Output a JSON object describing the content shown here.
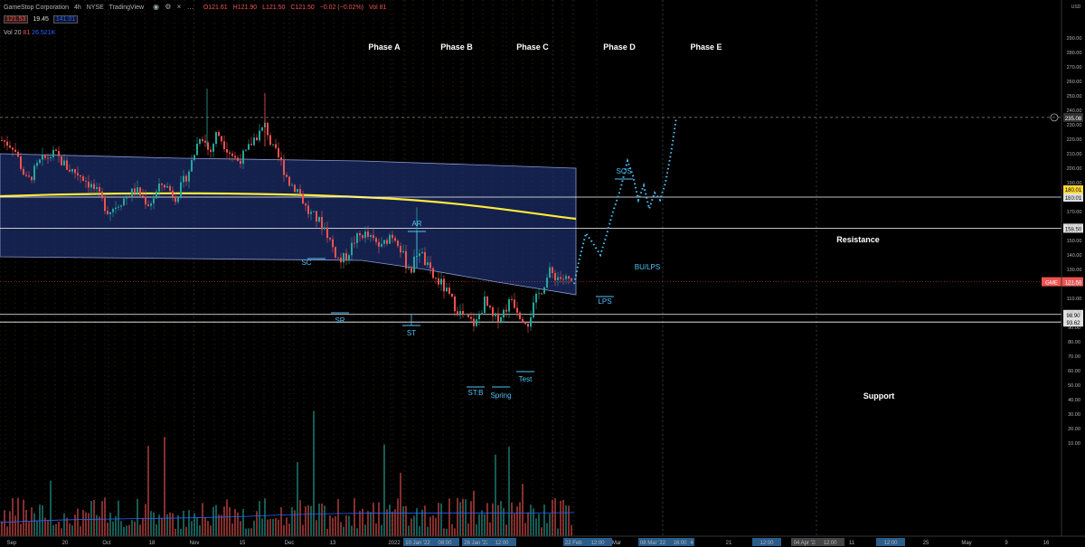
{
  "header": {
    "symbol": "GameStop Corporation",
    "interval": "4h",
    "exchange": "NYSE",
    "platform": "TradingView",
    "ohlc": {
      "o": "O121.61",
      "h": "H121.90",
      "l": "L121.50",
      "c": "C121.50",
      "chg": "−0.02 (−0.02%)",
      "vol": "Vol 81"
    },
    "bid": "121.53",
    "spread": "19.45",
    "ask": "141.01",
    "volume_label": "Vol 20",
    "volume_value": "81",
    "volume_ma": "26.521K",
    "icons": [
      "eye-icon",
      "settings-icon",
      "close-icon",
      "more-icon"
    ]
  },
  "colors": {
    "bg": "#000000",
    "up": "#26a69a",
    "down": "#ef5350",
    "band": "#1e2f6e",
    "ma": "#ffeb3b",
    "annot": "#4fc3f7",
    "line": "#ffffff"
  },
  "chart_data": {
    "type": "candlestick",
    "ylim": [
      0,
      300
    ],
    "ytick_labels": [
      "290.00",
      "280.00",
      "270.00",
      "260.00",
      "250.00",
      "240.00",
      "230.00",
      "220.00",
      "210.00",
      "200.00",
      "190.00",
      "180.00",
      "170.00",
      "160.00",
      "150.00",
      "140.00",
      "130.00",
      "120.00",
      "110.00",
      "100.00",
      "90.00",
      "80.00",
      "70.00",
      "60.00",
      "50.00",
      "40.00",
      "30.00",
      "20.00",
      "10.00"
    ],
    "ytick_values": [
      290,
      280,
      270,
      260,
      250,
      240,
      230,
      220,
      210,
      200,
      190,
      180,
      170,
      160,
      150,
      140,
      130,
      120,
      110,
      100,
      90,
      80,
      70,
      60,
      50,
      40,
      30,
      20,
      10
    ],
    "currency": "USD",
    "xtick_labels": [
      "Sep",
      "20",
      "Oct",
      "18",
      "Nov",
      "15",
      "Dec",
      "13",
      "2022",
      "10 Jan '22",
      "08:00",
      "26 Jan '22",
      "12:00",
      "22 Feb '22",
      "12:00",
      "Mar",
      "08 Mar '22",
      "16:00",
      "4",
      "21",
      "12:00",
      "04 Apr '22",
      "12:00",
      "11",
      "12:00",
      "25",
      "May",
      "9",
      "16"
    ],
    "price_path": [
      [
        0,
        220
      ],
      [
        15,
        215
      ],
      [
        30,
        190
      ],
      [
        45,
        205
      ],
      [
        60,
        210
      ],
      [
        75,
        200
      ],
      [
        90,
        195
      ],
      [
        105,
        185
      ],
      [
        120,
        170
      ],
      [
        135,
        178
      ],
      [
        150,
        185
      ],
      [
        165,
        175
      ],
      [
        180,
        190
      ],
      [
        195,
        180
      ],
      [
        210,
        200
      ],
      [
        222,
        225
      ],
      [
        232,
        210
      ],
      [
        240,
        225
      ],
      [
        250,
        215
      ],
      [
        262,
        205
      ],
      [
        272,
        210
      ],
      [
        280,
        220
      ],
      [
        288,
        225
      ],
      [
        294,
        230
      ],
      [
        300,
        215
      ],
      [
        310,
        205
      ],
      [
        320,
        190
      ],
      [
        330,
        185
      ],
      [
        340,
        170
      ],
      [
        350,
        165
      ],
      [
        360,
        158
      ],
      [
        368,
        145
      ],
      [
        376,
        135
      ],
      [
        384,
        140
      ],
      [
        392,
        150
      ],
      [
        402,
        155
      ],
      [
        412,
        150
      ],
      [
        422,
        145
      ],
      [
        432,
        155
      ],
      [
        440,
        150
      ],
      [
        448,
        135
      ],
      [
        455,
        130
      ],
      [
        463,
        145
      ],
      [
        470,
        135
      ],
      [
        478,
        125
      ],
      [
        488,
        120
      ],
      [
        498,
        110
      ],
      [
        508,
        100
      ],
      [
        518,
        95
      ],
      [
        526,
        92
      ],
      [
        536,
        108
      ],
      [
        546,
        95
      ],
      [
        556,
        100
      ],
      [
        566,
        110
      ],
      [
        576,
        98
      ],
      [
        584,
        94
      ],
      [
        592,
        108
      ],
      [
        600,
        118
      ],
      [
        608,
        128
      ],
      [
        616,
        125
      ],
      [
        626,
        123
      ],
      [
        635,
        120
      ]
    ],
    "projection": [
      [
        635,
        120
      ],
      [
        640,
        135
      ],
      [
        648,
        155
      ],
      [
        656,
        148
      ],
      [
        664,
        140
      ],
      [
        670,
        152
      ],
      [
        678,
        170
      ],
      [
        686,
        185
      ],
      [
        694,
        205
      ],
      [
        700,
        195
      ],
      [
        706,
        178
      ],
      [
        712,
        188
      ],
      [
        718,
        172
      ],
      [
        724,
        183
      ],
      [
        730,
        178
      ],
      [
        736,
        190
      ],
      [
        742,
        210
      ],
      [
        748,
        235
      ]
    ],
    "ma_label": "",
    "levels": [
      {
        "name": "Resistance",
        "value": 180.01,
        "label": "180.01"
      },
      {
        "name": "",
        "value": 158.5,
        "label": "158.50"
      },
      {
        "name": "Support",
        "value": 98.9,
        "label": "98.90"
      },
      {
        "name": "",
        "value": 93.62,
        "label": "93.62"
      }
    ],
    "current_price": {
      "ticker": "GME",
      "value": 121.5,
      "label": "121.50"
    },
    "target_price": {
      "value": 235.08,
      "label": "235.08"
    },
    "ma_price_label": "180.01",
    "phases": [
      "Phase A",
      "Phase B",
      "Phase C",
      "Phase D",
      "Phase E"
    ],
    "events": [
      {
        "label": "SC",
        "price": 160
      },
      {
        "label": "SR",
        "price": 130
      },
      {
        "label": "AR",
        "price": 175
      },
      {
        "label": "ST",
        "price": 122
      },
      {
        "label": "ST:B",
        "price": 88
      },
      {
        "label": "Spring",
        "price": 88
      },
      {
        "label": "Test",
        "price": 95
      },
      {
        "label": "LPS",
        "price": 135
      },
      {
        "label": "SOS",
        "price": 203
      },
      {
        "label": "BU/LPS",
        "price": 158
      }
    ],
    "annotations": [
      "Resistance",
      "Support"
    ]
  }
}
